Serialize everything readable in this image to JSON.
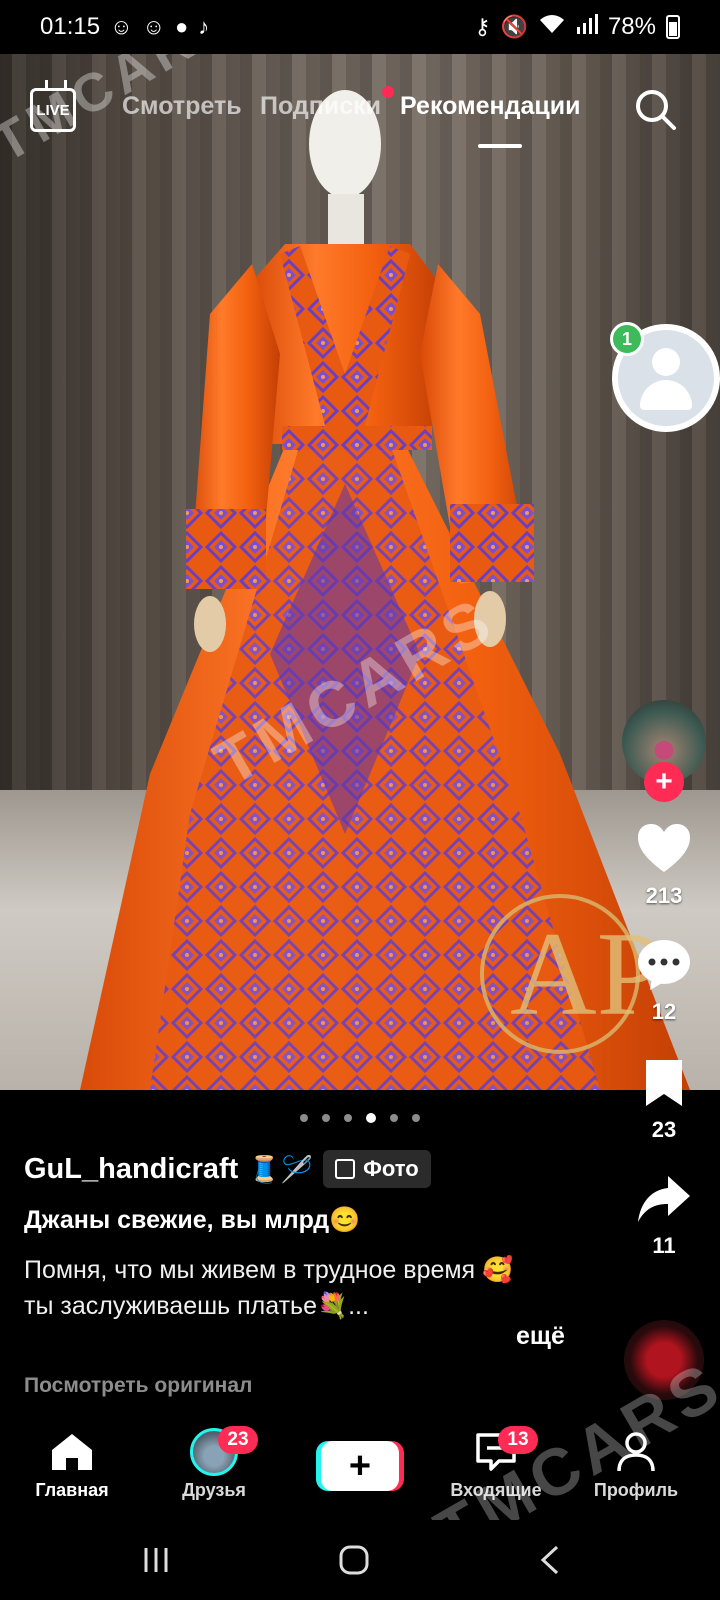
{
  "status_bar": {
    "time": "01:15",
    "battery": "78%",
    "left_icons": [
      "snapchat-icon",
      "snapchat-icon",
      "imo-icon",
      "tiktok-icon"
    ],
    "right_icons": [
      "vpn-key-icon",
      "mute-icon",
      "wifi-icon",
      "signal-icon",
      "battery-icon"
    ]
  },
  "top_nav": {
    "live_label": "LIVE",
    "tabs": [
      {
        "label": "Смотреть",
        "active": false
      },
      {
        "label": "Подписки",
        "active": false,
        "has_dot": true
      },
      {
        "label": "Рекомендации",
        "active": true
      }
    ]
  },
  "watermarks": [
    "TMCARS",
    "TMCARS",
    "TMCARS"
  ],
  "rail": {
    "creator_badge": "1",
    "like_count": "213",
    "comment_count": "12",
    "bookmark_count": "23",
    "share_count": "11"
  },
  "carousel": {
    "total": 6,
    "active_index": 3
  },
  "post": {
    "author": "GuL_handicraft",
    "author_emoji": "🧵🪡",
    "photo_tag": "Фото",
    "title": "Джаны свежие, вы млрд😊",
    "body_line1": "Помня, что мы живем в трудное время 🥰",
    "body_line2": "ты заслуживаешь платье💐...",
    "more_label": "ещё",
    "see_original": "Посмотреть оригинал"
  },
  "bottom_nav": {
    "home": "Главная",
    "friends": "Друзья",
    "friends_badge": "23",
    "inbox": "Входящие",
    "inbox_badge": "13",
    "profile": "Профиль"
  },
  "colors": {
    "accent": "#fe2c55",
    "cyan": "#25f4ee",
    "dress_orange": "#f2600f",
    "embroidery_purple": "#6a3fc2"
  }
}
